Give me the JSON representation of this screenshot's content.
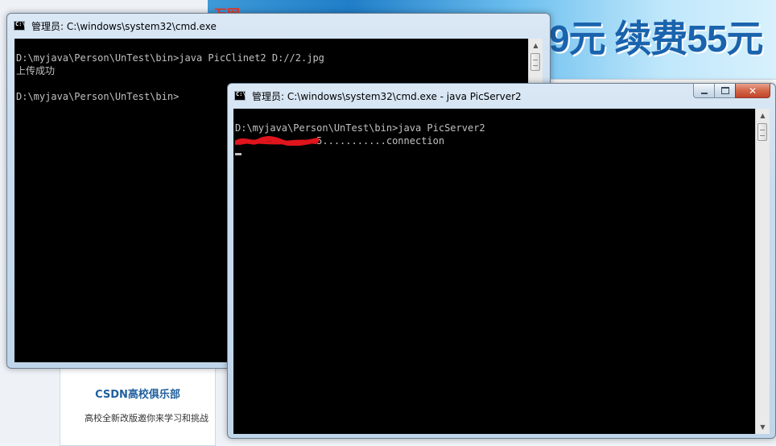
{
  "background": {
    "banner_logo": "万网",
    "banner_promo": "9元 续费55元",
    "club_title": "CSDN高校俱乐部",
    "club_desc": "高校全新改版邀你来学习和挑战"
  },
  "window_client": {
    "title": "管理员: C:\\windows\\system32\\cmd.exe",
    "lines": [
      "",
      "D:\\myjava\\Person\\UnTest\\bin>java PicClinet2 D://2.jpg",
      "上传成功",
      "",
      "D:\\myjava\\Person\\UnTest\\bin>"
    ]
  },
  "window_server": {
    "title": "管理员: C:\\windows\\system32\\cmd.exe - java  PicServer2",
    "lines": [
      "",
      "D:\\myjava\\Person\\UnTest\\bin>java PicServer2",
      "              5...........connection"
    ]
  },
  "controls": {
    "close_glyph": "✕"
  },
  "colors": {
    "console_bg": "#000000",
    "console_fg": "#c0c0c0",
    "redaction": "#e0141c"
  }
}
